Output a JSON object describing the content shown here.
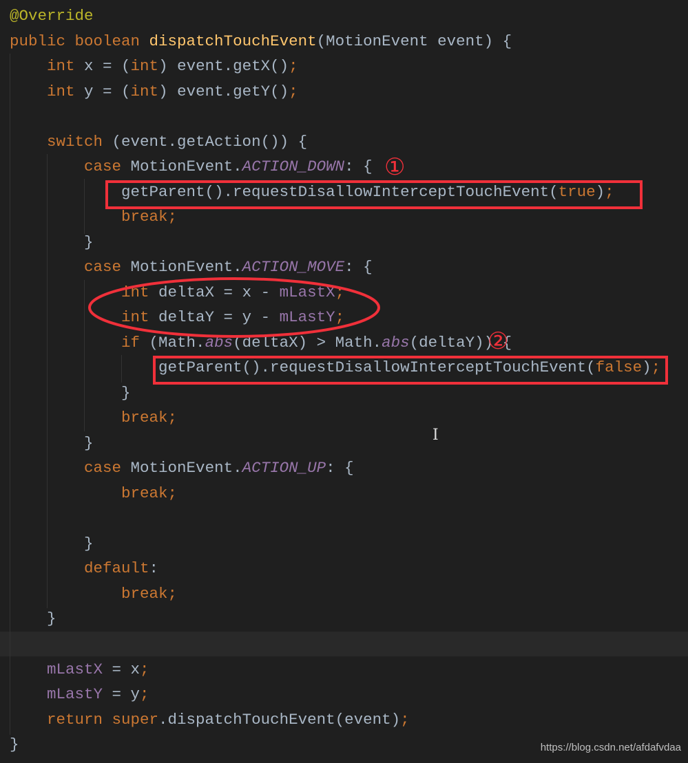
{
  "colors": {
    "background": "#1f1f1f",
    "keyword": "#cc7832",
    "text": "#a9b7c6",
    "function": "#ffc66d",
    "annotation": "#bbb529",
    "constant": "#9876aa",
    "annotation_mark": "#f0303a"
  },
  "current_line": 26,
  "code": {
    "lines": [
      {
        "tokens": [
          {
            "t": "@Override",
            "c": "an"
          }
        ]
      },
      {
        "tokens": [
          {
            "t": "public boolean ",
            "c": "kw"
          },
          {
            "t": "dispatchTouchEvent",
            "c": "fn"
          },
          {
            "t": "(MotionEvent event) {",
            "c": "tx"
          }
        ]
      },
      {
        "tokens": [
          {
            "t": "    ",
            "c": "tx"
          },
          {
            "t": "int ",
            "c": "kw"
          },
          {
            "t": "x = (",
            "c": "tx"
          },
          {
            "t": "int",
            "c": "kw"
          },
          {
            "t": ") event.getX()",
            "c": "tx"
          },
          {
            "t": ";",
            "c": "kw"
          }
        ]
      },
      {
        "tokens": [
          {
            "t": "    ",
            "c": "tx"
          },
          {
            "t": "int ",
            "c": "kw"
          },
          {
            "t": "y = (",
            "c": "tx"
          },
          {
            "t": "int",
            "c": "kw"
          },
          {
            "t": ") event.getY()",
            "c": "tx"
          },
          {
            "t": ";",
            "c": "kw"
          }
        ]
      },
      {
        "tokens": []
      },
      {
        "tokens": [
          {
            "t": "    ",
            "c": "tx"
          },
          {
            "t": "switch ",
            "c": "kw"
          },
          {
            "t": "(event.getAction()) {",
            "c": "tx"
          }
        ]
      },
      {
        "tokens": [
          {
            "t": "        ",
            "c": "tx"
          },
          {
            "t": "case ",
            "c": "kw"
          },
          {
            "t": "MotionEvent.",
            "c": "tx"
          },
          {
            "t": "ACTION_DOWN",
            "c": "cn"
          },
          {
            "t": ": {",
            "c": "tx"
          }
        ]
      },
      {
        "tokens": [
          {
            "t": "            getParent().requestDisallowInterceptTouchEvent(",
            "c": "tx"
          },
          {
            "t": "true",
            "c": "kw"
          },
          {
            "t": ")",
            "c": "tx"
          },
          {
            "t": ";",
            "c": "kw"
          }
        ]
      },
      {
        "tokens": [
          {
            "t": "            ",
            "c": "tx"
          },
          {
            "t": "break;",
            "c": "kw"
          }
        ]
      },
      {
        "tokens": [
          {
            "t": "        }",
            "c": "tx"
          }
        ]
      },
      {
        "tokens": [
          {
            "t": "        ",
            "c": "tx"
          },
          {
            "t": "case ",
            "c": "kw"
          },
          {
            "t": "MotionEvent.",
            "c": "tx"
          },
          {
            "t": "ACTION_MOVE",
            "c": "cn"
          },
          {
            "t": ": {",
            "c": "tx"
          }
        ]
      },
      {
        "tokens": [
          {
            "t": "            ",
            "c": "tx"
          },
          {
            "t": "int ",
            "c": "kw"
          },
          {
            "t": "deltaX = x - ",
            "c": "tx"
          },
          {
            "t": "mLastX",
            "c": "fd"
          },
          {
            "t": ";",
            "c": "kw"
          }
        ]
      },
      {
        "tokens": [
          {
            "t": "            ",
            "c": "tx"
          },
          {
            "t": "int ",
            "c": "kw"
          },
          {
            "t": "deltaY = y - ",
            "c": "tx"
          },
          {
            "t": "mLastY",
            "c": "fd"
          },
          {
            "t": ";",
            "c": "kw"
          }
        ]
      },
      {
        "tokens": [
          {
            "t": "            ",
            "c": "tx"
          },
          {
            "t": "if ",
            "c": "kw"
          },
          {
            "t": "(Math.",
            "c": "tx"
          },
          {
            "t": "abs",
            "c": "st"
          },
          {
            "t": "(deltaX) > Math.",
            "c": "tx"
          },
          {
            "t": "abs",
            "c": "st"
          },
          {
            "t": "(deltaY)) {",
            "c": "tx"
          }
        ]
      },
      {
        "tokens": [
          {
            "t": "                getParent().requestDisallowInterceptTouchEvent(",
            "c": "tx"
          },
          {
            "t": "false",
            "c": "kw"
          },
          {
            "t": ")",
            "c": "tx"
          },
          {
            "t": ";",
            "c": "kw"
          }
        ]
      },
      {
        "tokens": [
          {
            "t": "            }",
            "c": "tx"
          }
        ]
      },
      {
        "tokens": [
          {
            "t": "            ",
            "c": "tx"
          },
          {
            "t": "break;",
            "c": "kw"
          }
        ]
      },
      {
        "tokens": [
          {
            "t": "        }",
            "c": "tx"
          }
        ]
      },
      {
        "tokens": [
          {
            "t": "        ",
            "c": "tx"
          },
          {
            "t": "case ",
            "c": "kw"
          },
          {
            "t": "MotionEvent.",
            "c": "tx"
          },
          {
            "t": "ACTION_UP",
            "c": "cn"
          },
          {
            "t": ": {",
            "c": "tx"
          }
        ]
      },
      {
        "tokens": [
          {
            "t": "            ",
            "c": "tx"
          },
          {
            "t": "break;",
            "c": "kw"
          }
        ]
      },
      {
        "tokens": []
      },
      {
        "tokens": [
          {
            "t": "        }",
            "c": "tx"
          }
        ]
      },
      {
        "tokens": [
          {
            "t": "        ",
            "c": "tx"
          },
          {
            "t": "default",
            "c": "kw"
          },
          {
            "t": ":",
            "c": "tx"
          }
        ]
      },
      {
        "tokens": [
          {
            "t": "            ",
            "c": "tx"
          },
          {
            "t": "break;",
            "c": "kw"
          }
        ]
      },
      {
        "tokens": [
          {
            "t": "    }",
            "c": "tx"
          }
        ]
      },
      {
        "tokens": []
      },
      {
        "tokens": [
          {
            "t": "    ",
            "c": "tx"
          },
          {
            "t": "mLastX",
            "c": "fd"
          },
          {
            "t": " = x",
            "c": "tx"
          },
          {
            "t": ";",
            "c": "kw"
          }
        ]
      },
      {
        "tokens": [
          {
            "t": "    ",
            "c": "tx"
          },
          {
            "t": "mLastY",
            "c": "fd"
          },
          {
            "t": " = y",
            "c": "tx"
          },
          {
            "t": ";",
            "c": "kw"
          }
        ]
      },
      {
        "tokens": [
          {
            "t": "    ",
            "c": "tx"
          },
          {
            "t": "return super",
            "c": "kw"
          },
          {
            "t": ".dispatchTouchEvent(event)",
            "c": "tx"
          },
          {
            "t": ";",
            "c": "kw"
          }
        ]
      },
      {
        "tokens": [
          {
            "t": "}",
            "c": "tx"
          }
        ]
      }
    ]
  },
  "annotations": {
    "marker1": "①",
    "marker2": "②"
  },
  "watermark": "https://blog.csdn.net/afdafvdaa"
}
